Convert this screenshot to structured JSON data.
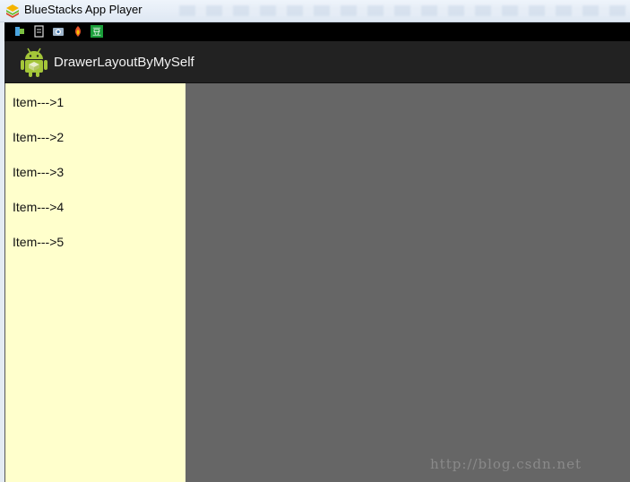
{
  "window": {
    "title": "BlueStacks App Player",
    "app_icon": "bluestacks-layers-icon"
  },
  "statusbar": {
    "icons": [
      "bluestacks-notify-icon",
      "document-icon",
      "camera-icon",
      "flame-app-icon",
      "green-app-icon"
    ],
    "green_icon_glyph": "豆"
  },
  "actionbar": {
    "icon": "android-robot-icon",
    "title": "DrawerLayoutByMySelf",
    "background": "#222222"
  },
  "drawer": {
    "background": "#ffffcc",
    "items": [
      {
        "label": "Item--->1"
      },
      {
        "label": "Item--->2"
      },
      {
        "label": "Item--->3"
      },
      {
        "label": "Item--->4"
      },
      {
        "label": "Item--->5"
      }
    ]
  },
  "content": {
    "scrim_color": "#666666"
  },
  "watermark": {
    "text": "http://blog.csdn.net"
  }
}
